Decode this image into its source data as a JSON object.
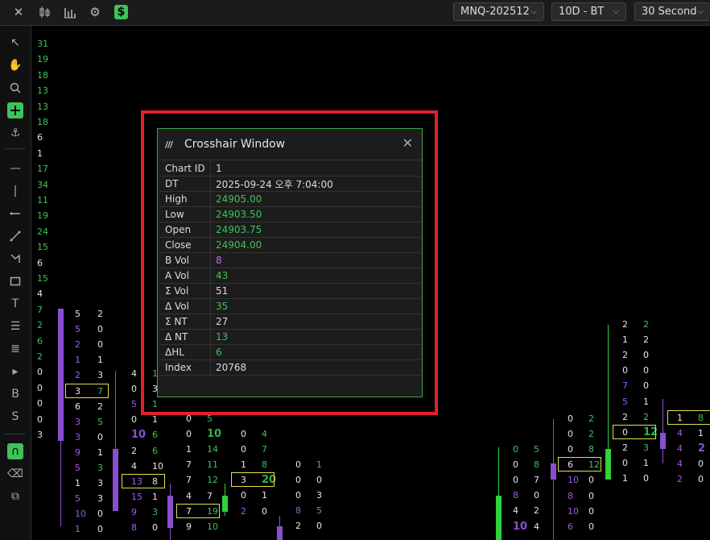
{
  "toolbar": {
    "symbol": "MNQ-202512",
    "range": "10D - BT",
    "interval": "30 Second"
  },
  "crosshair": {
    "title": "Crosshair Window",
    "rows": [
      {
        "label": "Chart ID",
        "value": "1",
        "color": "w"
      },
      {
        "label": "DT",
        "value": "2025-09-24 오후 7:04:00",
        "color": "w"
      },
      {
        "label": "High",
        "value": "24905.00",
        "color": "g"
      },
      {
        "label": "Low",
        "value": "24903.50",
        "color": "g"
      },
      {
        "label": "Open",
        "value": "24903.75",
        "color": "g"
      },
      {
        "label": "Close",
        "value": "24904.00",
        "color": "g"
      },
      {
        "label": "B Vol",
        "value": "8",
        "color": "p"
      },
      {
        "label": "A Vol",
        "value": "43",
        "color": "g"
      },
      {
        "label": "Σ Vol",
        "value": "51",
        "color": "w"
      },
      {
        "label": "Δ Vol",
        "value": "35",
        "color": "g"
      },
      {
        "label": "Σ NT",
        "value": "27",
        "color": "w"
      },
      {
        "label": "Δ NT",
        "value": "13",
        "color": "g"
      },
      {
        "label": "ΔHL",
        "value": "6",
        "color": "g"
      },
      {
        "label": "Index",
        "value": "20768",
        "color": "w"
      }
    ]
  },
  "left_column": [
    "31",
    "19",
    "18",
    "13",
    "13",
    "18",
    "6",
    "1",
    "17",
    "34",
    "11",
    "19",
    "24",
    "15",
    "6",
    "15",
    "4",
    "7",
    "2",
    "6",
    "2",
    "0",
    "0",
    "0",
    "0",
    "3"
  ],
  "columns": [
    {
      "cells": [
        [
          "5",
          "2"
        ],
        [
          "5",
          "0"
        ],
        [
          "2",
          "0"
        ],
        [
          "1",
          "1"
        ],
        [
          "2",
          "3"
        ],
        [
          "3",
          "7"
        ],
        [
          "6",
          "2"
        ],
        [
          "3",
          "5"
        ],
        [
          "3",
          "0"
        ],
        [
          "9",
          "1"
        ],
        [
          "5",
          "3"
        ],
        [
          "1",
          "3"
        ],
        [
          "5",
          "3"
        ],
        [
          "10",
          "0"
        ],
        [
          "1",
          "0"
        ]
      ]
    },
    {
      "cells": [
        [
          "4",
          "1"
        ],
        [
          "0",
          "3"
        ],
        [
          "5",
          "1"
        ],
        [
          "0",
          "1"
        ],
        [
          "10",
          "6"
        ],
        [
          "2",
          "6"
        ],
        [
          "4",
          "10"
        ],
        [
          "13",
          "8"
        ],
        [
          "15",
          "1"
        ],
        [
          "9",
          "3"
        ],
        [
          "8",
          "0"
        ]
      ]
    },
    {
      "cells": [
        [
          "0",
          "5"
        ],
        [
          "0",
          "10"
        ],
        [
          "1",
          "14"
        ],
        [
          "7",
          "11"
        ],
        [
          "7",
          "12"
        ],
        [
          "4",
          "7"
        ],
        [
          "7",
          "19"
        ],
        [
          "9",
          "10"
        ]
      ]
    },
    {
      "cells": [
        [
          "0",
          "4"
        ],
        [
          "0",
          "7"
        ],
        [
          "1",
          "8"
        ],
        [
          "3",
          "20"
        ],
        [
          "0",
          "1"
        ],
        [
          "2",
          "0"
        ]
      ]
    },
    {
      "cells": [
        [
          "0",
          "1"
        ],
        [
          "0",
          "0"
        ],
        [
          "0",
          "3"
        ],
        [
          "8",
          "5"
        ],
        [
          "2",
          "0"
        ]
      ]
    },
    {
      "cells": [
        [
          "0",
          "5"
        ],
        [
          "0",
          "8"
        ],
        [
          "0",
          "7"
        ],
        [
          "8",
          "0"
        ],
        [
          "4",
          "2"
        ],
        [
          "10",
          "4"
        ]
      ]
    },
    {
      "cells": [
        [
          "0",
          "2"
        ],
        [
          "0",
          "2"
        ],
        [
          "0",
          "8"
        ],
        [
          "6",
          "12"
        ],
        [
          "10",
          "0"
        ],
        [
          "8",
          "0"
        ],
        [
          "10",
          "0"
        ],
        [
          "6",
          "0"
        ]
      ]
    },
    {
      "cells": [
        [
          "2",
          "2"
        ],
        [
          "1",
          "2"
        ],
        [
          "2",
          "0"
        ],
        [
          "0",
          "0"
        ],
        [
          "7",
          "0"
        ],
        [
          "5",
          "1"
        ],
        [
          "2",
          "2"
        ],
        [
          "0",
          "12"
        ],
        [
          "2",
          "3"
        ],
        [
          "0",
          "1"
        ],
        [
          "1",
          "0"
        ]
      ]
    },
    {
      "cells": [
        [
          "1",
          "8"
        ],
        [
          "4",
          "1"
        ],
        [
          "4",
          "2"
        ],
        [
          "4",
          "0"
        ],
        [
          "2",
          "0"
        ]
      ]
    }
  ]
}
